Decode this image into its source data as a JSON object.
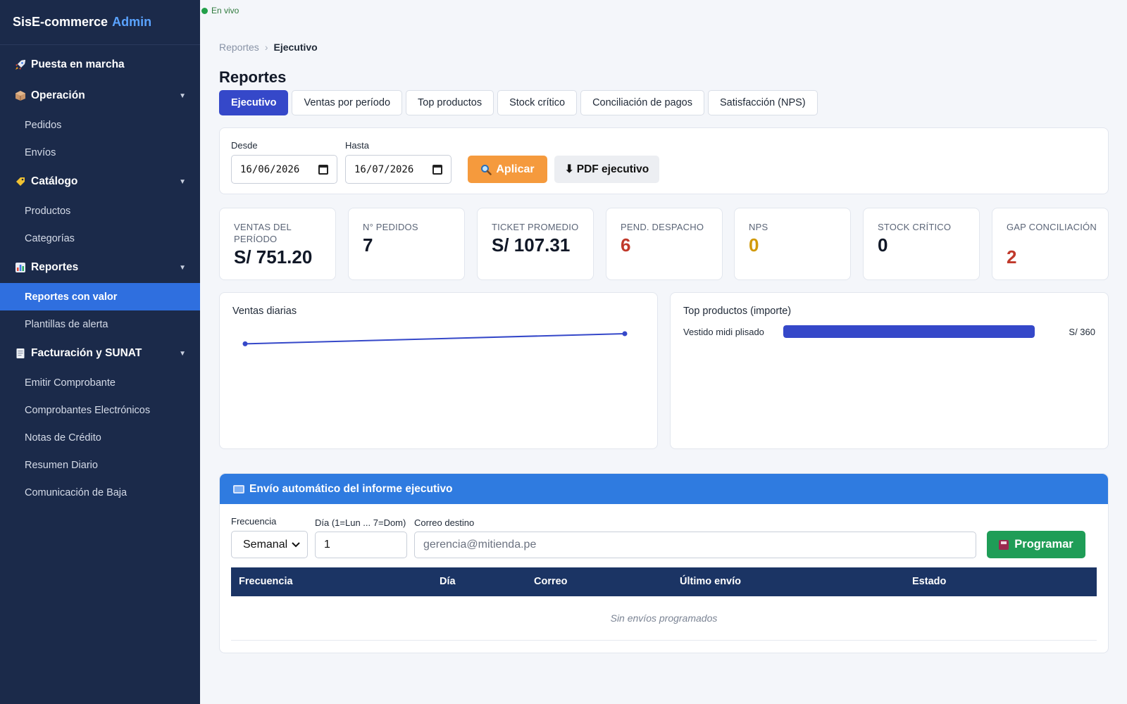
{
  "brand": {
    "name": "SisE-commerce",
    "accent": "Admin"
  },
  "sidebar": {
    "groups": [
      {
        "label": "Puesta en marcha",
        "icon": "rocket-icon",
        "items": []
      },
      {
        "label": "Operación",
        "icon": "package-icon",
        "items": [
          "Pedidos",
          "Envíos"
        ]
      },
      {
        "label": "Catálogo",
        "icon": "tag-icon",
        "items": [
          "Productos",
          "Categorías"
        ]
      },
      {
        "label": "Reportes",
        "icon": "bar-chart-icon",
        "items": [
          "Reportes con valor",
          "Plantillas de alerta"
        ]
      },
      {
        "label": "Facturación y SUNAT",
        "icon": "receipt-icon",
        "items": [
          "Emitir Comprobante",
          "Comprobantes Electrónicos",
          "Notas de Crédito",
          "Resumen Diario",
          "Comunicación de Baja"
        ]
      }
    ],
    "active_item": "Reportes con valor"
  },
  "status": {
    "live": "En vivo"
  },
  "breadcrumb": {
    "parent": "Reportes",
    "separator": "›",
    "current": "Ejecutivo"
  },
  "page": {
    "title": "Reportes"
  },
  "tabs": [
    {
      "label": "Ejecutivo",
      "active": true
    },
    {
      "label": "Ventas por período",
      "active": false
    },
    {
      "label": "Top productos",
      "active": false
    },
    {
      "label": "Stock crítico",
      "active": false
    },
    {
      "label": "Conciliación de pagos",
      "active": false
    },
    {
      "label": "Satisfacción (NPS)",
      "active": false
    }
  ],
  "filter": {
    "from_label": "Desde",
    "from_value": "16/06/2026",
    "to_label": "Hasta",
    "to_value": "16/07/2026",
    "apply_label": "Aplicar",
    "pdf_label": "PDF ejecutivo"
  },
  "kpis": [
    {
      "label": "Ventas del período",
      "value": "S/ 751.20",
      "tone": "default"
    },
    {
      "label": "N° pedidos",
      "value": "7",
      "tone": "default"
    },
    {
      "label": "Ticket promedio",
      "value": "S/ 107.31",
      "tone": "default"
    },
    {
      "label": "Pend. despacho",
      "value": "6",
      "tone": "red"
    },
    {
      "label": "NPS",
      "value": "0",
      "tone": "amber"
    },
    {
      "label": "Stock crítico",
      "value": "0",
      "tone": "default"
    },
    {
      "label": "Gap conciliación",
      "value": "2",
      "tone": "red"
    }
  ],
  "chart_data": [
    {
      "type": "line",
      "title": "Ventas diarias",
      "x": [
        0,
        1
      ],
      "y": [
        0.32,
        0.4
      ],
      "color": "#3548c9"
    },
    {
      "type": "bar",
      "title": "Top productos (importe)",
      "categories": [
        "Vestido midi plisado"
      ],
      "values": [
        360
      ],
      "value_labels": [
        "S/ 360"
      ],
      "color": "#3548c9"
    }
  ],
  "schedule": {
    "title": "Envío automático del informe ejecutivo",
    "freq_label": "Frecuencia",
    "freq_value": "Semanal",
    "day_label": "Día (1=Lun ... 7=Dom)",
    "day_value": "1",
    "email_label": "Correo destino",
    "email_placeholder": "gerencia@mitienda.pe",
    "button_label": "Programar",
    "columns": [
      "Frecuencia",
      "Día",
      "Correo",
      "Último envío",
      "Estado"
    ],
    "empty_text": "Sin envíos programados"
  },
  "colors": {
    "sidebar": "#1b2a4a",
    "accent": "#3548c9",
    "apply": "#f59a3d",
    "success": "#1f9d57",
    "header_blue": "#2f7be0"
  }
}
